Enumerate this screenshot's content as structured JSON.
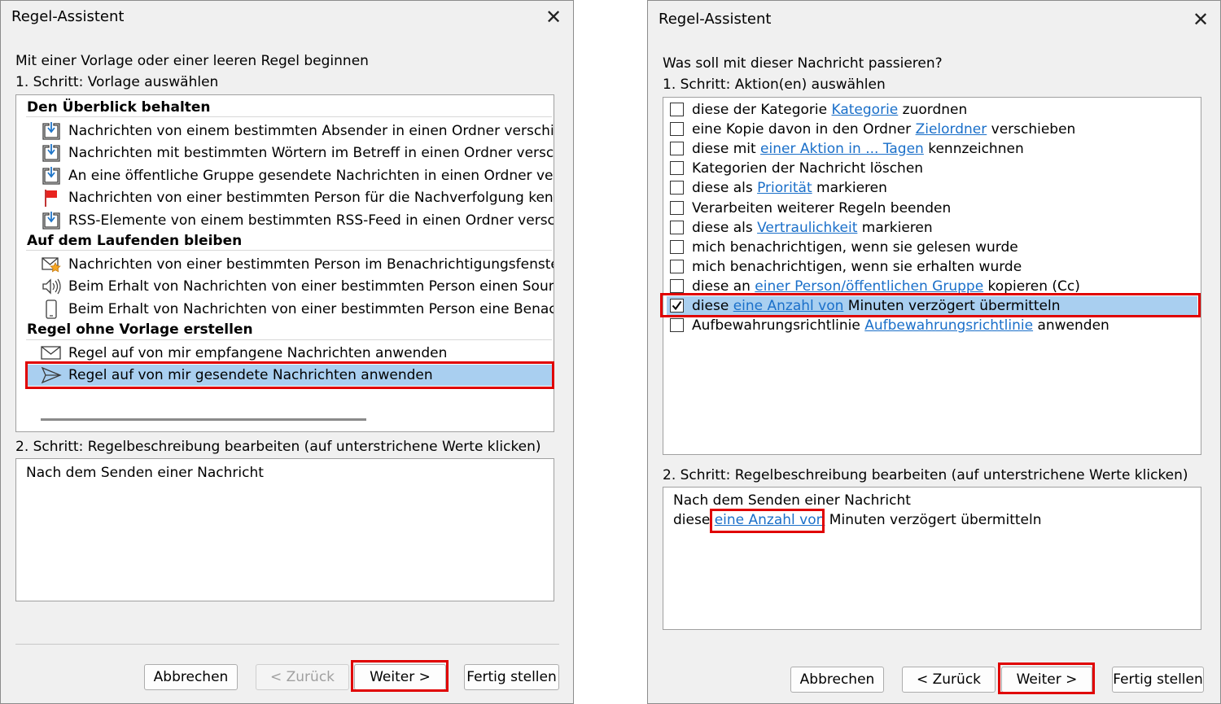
{
  "left": {
    "title": "Regel-Assistent",
    "intro": "Mit einer Vorlage oder einer leeren Regel beginnen",
    "step1": "1. Schritt: Vorlage auswählen",
    "groups": [
      {
        "label": "Den Überblick behalten",
        "items": [
          {
            "icon": "folder-move-icon",
            "label": "Nachrichten von einem bestimmten Absender in einen Ordner verschieb"
          },
          {
            "icon": "folder-move-icon",
            "label": "Nachrichten mit bestimmten Wörtern im Betreff in einen Ordner verschie"
          },
          {
            "icon": "folder-move-icon",
            "label": "An eine öffentliche Gruppe gesendete Nachrichten in einen Ordner vers"
          },
          {
            "icon": "red-flag-icon",
            "label": "Nachrichten von einer bestimmten Person für die Nachverfolgung kenn:"
          },
          {
            "icon": "folder-move-icon",
            "label": "RSS-Elemente von einem bestimmten RSS-Feed in einen Ordner verschie"
          }
        ]
      },
      {
        "label": "Auf dem Laufenden bleiben",
        "items": [
          {
            "icon": "mail-star-icon",
            "label": "Nachrichten von einer bestimmten Person im Benachrichtigungsfenster"
          },
          {
            "icon": "speaker-icon",
            "label": "Beim Erhalt von Nachrichten von einer bestimmten Person einen Sound"
          },
          {
            "icon": "mobile-phone-icon",
            "label": "Beim Erhalt von Nachrichten von einer bestimmten Person eine Benachri"
          }
        ]
      },
      {
        "label": "Regel ohne Vorlage erstellen",
        "items": [
          {
            "icon": "envelope-icon",
            "label": "Regel auf von mir empfangene Nachrichten anwenden"
          },
          {
            "icon": "send-icon",
            "label": "Regel auf von mir gesendete Nachrichten anwenden",
            "selected": true
          }
        ]
      }
    ],
    "step2": "2. Schritt: Regelbeschreibung bearbeiten (auf unterstrichene Werte klicken)",
    "description": "Nach dem Senden einer Nachricht",
    "buttons": {
      "cancel": "Abbrechen",
      "back": "< Zurück",
      "next": "Weiter >",
      "finish": "Fertig stellen"
    }
  },
  "right": {
    "title": "Regel-Assistent",
    "question": "Was soll mit dieser Nachricht passieren?",
    "step1": "1. Schritt: Aktion(en) auswählen",
    "actions": [
      {
        "pre": "diese der Kategorie ",
        "link": "Kategorie",
        "post": " zuordnen",
        "checked": false
      },
      {
        "pre": "eine Kopie davon in den Ordner ",
        "link": "Zielordner",
        "post": " verschieben",
        "checked": false
      },
      {
        "pre": "diese mit ",
        "link": "einer Aktion in ... Tagen",
        "post": " kennzeichnen",
        "checked": false
      },
      {
        "pre": "Kategorien der Nachricht löschen",
        "link": "",
        "post": "",
        "checked": false
      },
      {
        "pre": "diese als ",
        "link": "Priorität",
        "post": " markieren",
        "checked": false
      },
      {
        "pre": "Verarbeiten weiterer Regeln beenden",
        "link": "",
        "post": "",
        "checked": false
      },
      {
        "pre": "diese als ",
        "link": "Vertraulichkeit",
        "post": " markieren",
        "checked": false
      },
      {
        "pre": "mich benachrichtigen, wenn sie gelesen wurde",
        "link": "",
        "post": "",
        "checked": false
      },
      {
        "pre": "mich benachrichtigen, wenn sie erhalten wurde",
        "link": "",
        "post": "",
        "checked": false
      },
      {
        "pre": "diese an ",
        "link": "einer Person/öffentlichen Gruppe",
        "post": " kopieren (Cc)",
        "checked": false
      },
      {
        "pre": "diese ",
        "link": "eine Anzahl von",
        "post": " Minuten verzögert übermitteln",
        "checked": true,
        "selected": true
      },
      {
        "pre": "Aufbewahrungsrichtlinie ",
        "link": "Aufbewahrungsrichtlinie",
        "post": " anwenden",
        "checked": false
      }
    ],
    "step2": "2. Schritt: Regelbeschreibung bearbeiten (auf unterstrichene Werte klicken)",
    "desc_line1": "Nach dem Senden einer Nachricht",
    "desc_line2": {
      "pre": "diese ",
      "link": "eine Anzahl von",
      "post": " Minuten verzögert übermitteln"
    },
    "buttons": {
      "cancel": "Abbrechen",
      "back": "< Zurück",
      "next": "Weiter >",
      "finish": "Fertig stellen"
    }
  },
  "colors": {
    "selection": "#a9cff0",
    "highlight": "#e00000",
    "link": "#1a6fc9"
  }
}
